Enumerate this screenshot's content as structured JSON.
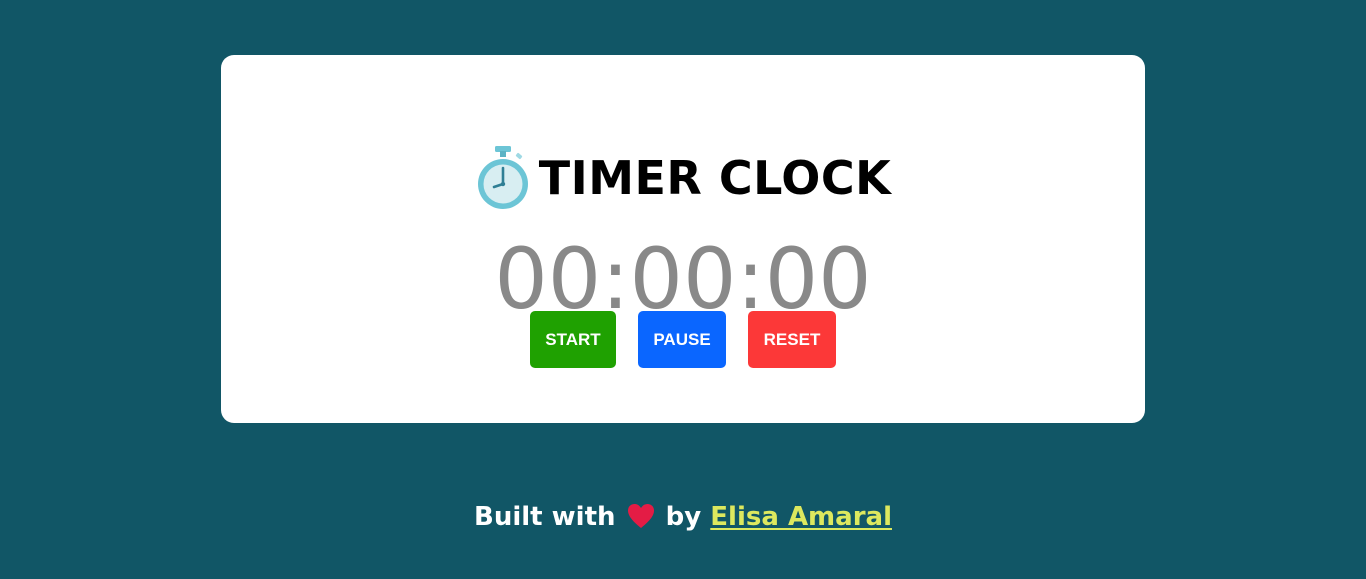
{
  "page": {
    "background_color": "#115666"
  },
  "card": {
    "title": "TIMER CLOCK",
    "title_icon": "stopwatch-icon",
    "time_display": "00:00:00"
  },
  "controls": {
    "start_label": "START",
    "pause_label": "PAUSE",
    "reset_label": "RESET",
    "start_color": "#1fa101",
    "pause_color": "#0a66ff",
    "reset_color": "#fc3838"
  },
  "footer": {
    "prefix": "Built with",
    "heart_icon": "heart-icon",
    "by_text": "by",
    "author_name": "Elisa Amaral",
    "author_link_color": "#dde85e"
  }
}
